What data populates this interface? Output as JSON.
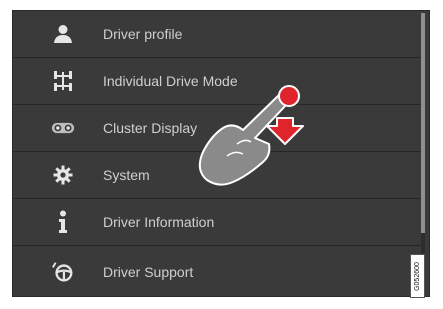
{
  "menu": {
    "items": [
      {
        "label": "Driver profile",
        "icon": "person-icon"
      },
      {
        "label": "Individual Drive Mode",
        "icon": "drive-mode-icon"
      },
      {
        "label": "Cluster Display",
        "icon": "cluster-display-icon"
      },
      {
        "label": "System",
        "icon": "gear-icon"
      },
      {
        "label": "Driver Information",
        "icon": "info-icon"
      },
      {
        "label": "Driver Support",
        "icon": "steering-wheel-icon"
      }
    ]
  },
  "gesture": {
    "type": "swipe-down",
    "icon": "hand-swipe-down-icon",
    "accent": "#e0242c"
  },
  "reference_code": "G052600",
  "colors": {
    "background": "#3a3a3a",
    "text": "#cfcfcf",
    "icon": "#e6e6e6",
    "accent": "#e0242c"
  }
}
